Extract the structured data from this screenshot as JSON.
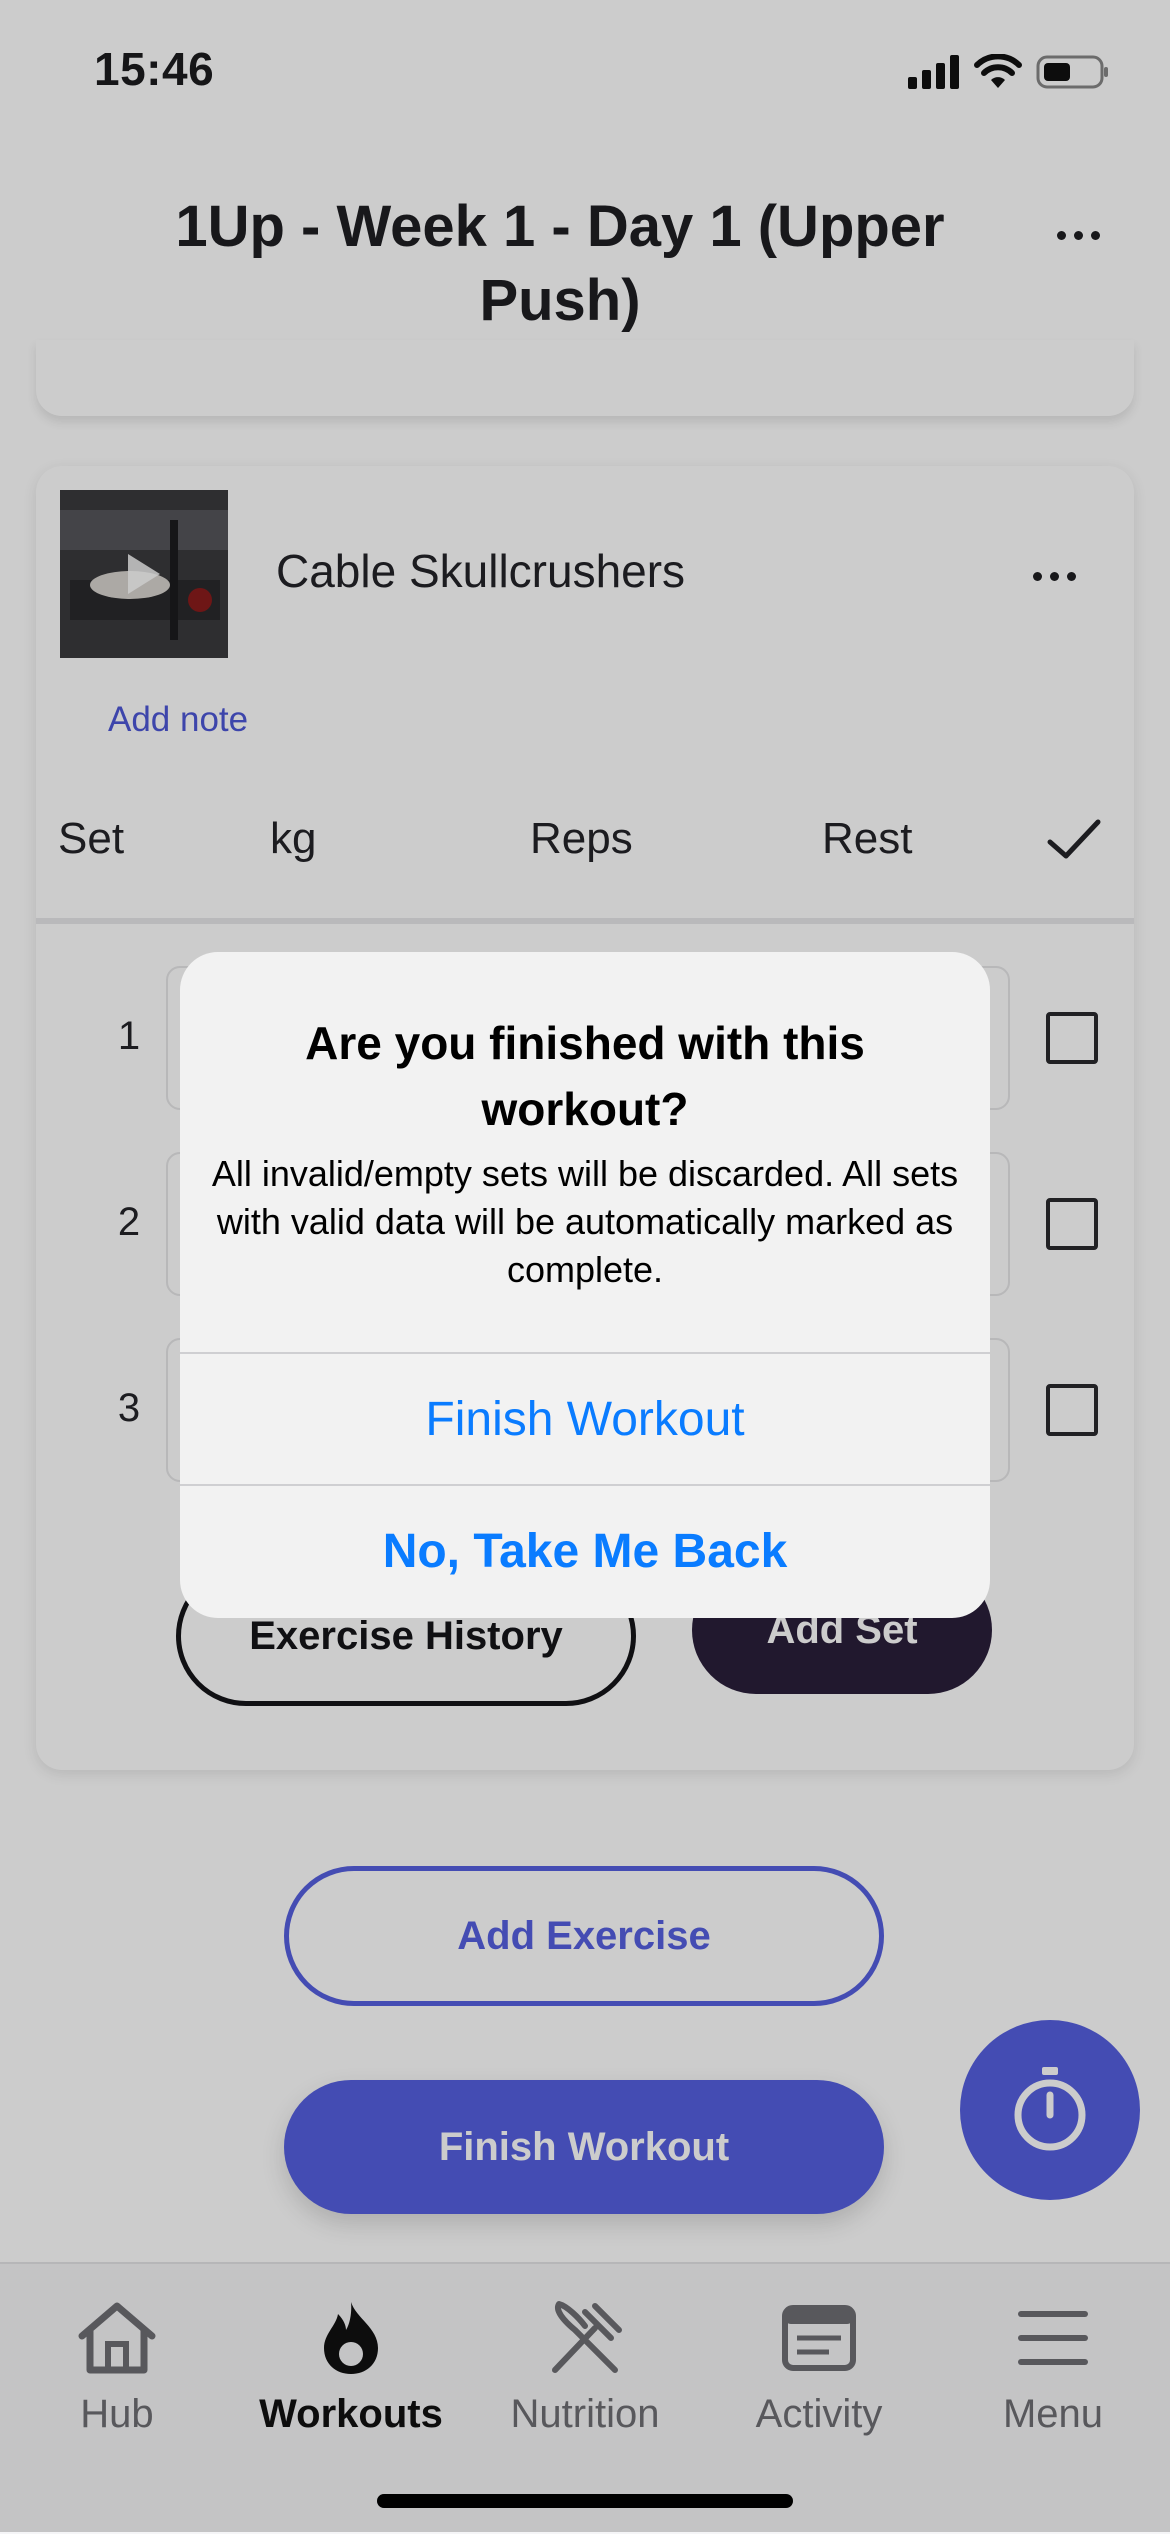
{
  "status_bar": {
    "time": "15:46"
  },
  "header": {
    "title": "1Up - Week 1 - Day 1 (Upper Push)"
  },
  "exercise": {
    "name": "Cable Skullcrushers",
    "add_note": "Add note",
    "columns": [
      "Set",
      "kg",
      "Reps",
      "Rest"
    ],
    "sets": [
      "1",
      "2",
      "3"
    ],
    "history_button": "Exercise History",
    "add_set_button": "Add Set"
  },
  "actions": {
    "add_exercise": "Add Exercise",
    "finish_workout": "Finish Workout"
  },
  "tabs": [
    {
      "label": "Hub",
      "icon": "home-icon"
    },
    {
      "label": "Workouts",
      "icon": "flame-icon",
      "active": true
    },
    {
      "label": "Nutrition",
      "icon": "fork-knife-icon"
    },
    {
      "label": "Activity",
      "icon": "activity-feed-icon"
    },
    {
      "label": "Menu",
      "icon": "hamburger-icon"
    }
  ],
  "dialog": {
    "title": "Are you finished with this workout?",
    "message": "All invalid/empty sets will be discarded. All sets with valid data will be automatically marked as complete.",
    "confirm": "Finish Workout",
    "cancel": "No, Take Me Back"
  },
  "colors": {
    "accent": "#5660e0",
    "ios_blue": "#0a7cff",
    "dark_button": "#2a1e3a"
  }
}
